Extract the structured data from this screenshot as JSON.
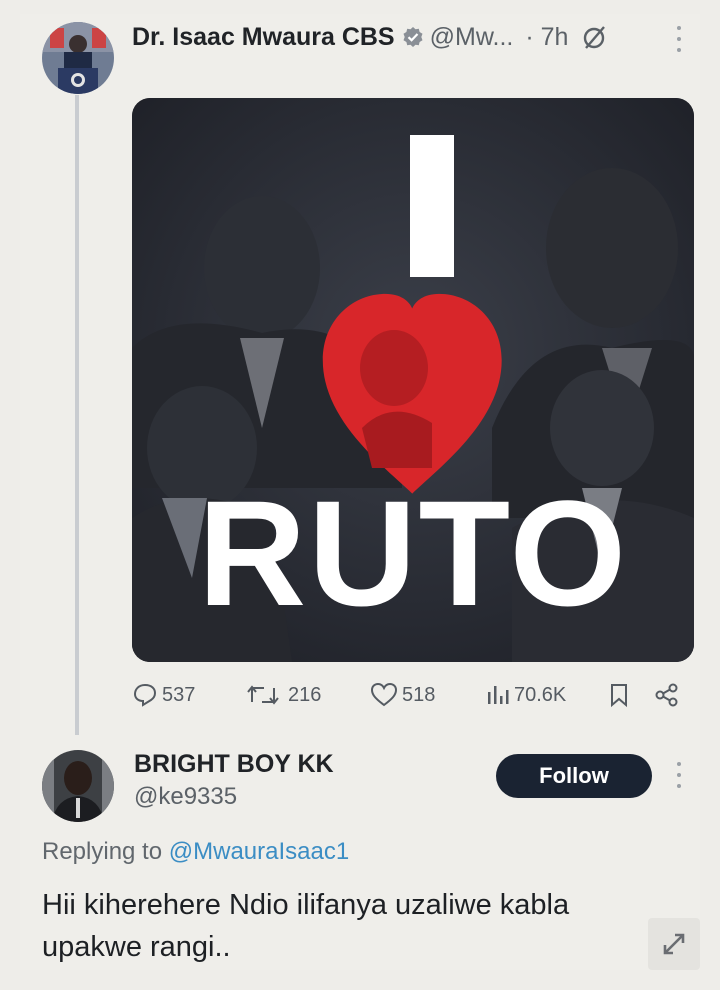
{
  "tweet": {
    "display_name": "Dr. Isaac Mwaura CBS",
    "handle": "@Mw...",
    "time": "· 7h",
    "image_text": {
      "top_letter": "I",
      "bottom_word": "RUTO"
    },
    "stats": {
      "replies": "537",
      "retweets": "216",
      "likes": "518",
      "views": "70.6K"
    }
  },
  "reply": {
    "display_name": "BRIGHT BOY KK",
    "handle": "@ke9335",
    "follow_label": "Follow",
    "replying_prefix": "Replying to",
    "replying_mention": "@MwauraIsaac1",
    "text": "Hii kiherehere Ndio ilifanya uzaliwe kabla upakwe rangi.."
  },
  "colors": {
    "verified": "#8a8f96",
    "follow_bg": "#1a2332",
    "mention": "#3b8dc4",
    "heart": "#d8262a"
  },
  "icons": [
    "verified-badge-icon",
    "grok-icon",
    "more-icon",
    "reply-icon",
    "retweet-icon",
    "like-icon",
    "views-icon",
    "bookmark-icon",
    "share-icon",
    "expand-icon"
  ]
}
